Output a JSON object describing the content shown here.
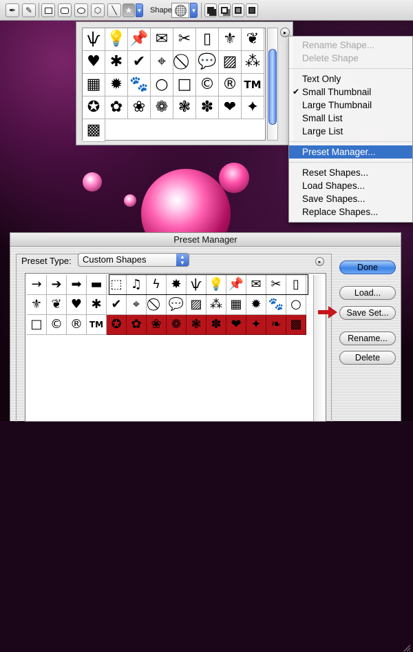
{
  "options_bar": {
    "tools": [
      {
        "name": "pen-tool",
        "glyph": "✒"
      },
      {
        "name": "freeform-pen-tool",
        "glyph": "✎"
      },
      {
        "name": "rectangle-tool",
        "glyph": ""
      },
      {
        "name": "rounded-rectangle-tool",
        "glyph": ""
      },
      {
        "name": "ellipse-tool",
        "glyph": ""
      },
      {
        "name": "polygon-tool",
        "glyph": "⬡"
      },
      {
        "name": "line-tool",
        "glyph": "╲"
      },
      {
        "name": "custom-shape-tool",
        "glyph": "★"
      }
    ],
    "shape_label": "Shape:",
    "combine_modes": [
      "add",
      "subtract",
      "intersect",
      "exclude"
    ]
  },
  "picker": {
    "shapes": [
      "ѱ",
      "💡",
      "📌",
      "✉",
      "✂",
      "▯",
      "⚜",
      "❦",
      "♥",
      "✱",
      "✔",
      "⌖",
      "⃠",
      "💬",
      "▨",
      "⁂",
      "▦",
      "✹",
      "🐾",
      "○",
      "□",
      "©",
      "®",
      "TM",
      "✪",
      "✿",
      "❀",
      "❁",
      "❃",
      "✽",
      "❤",
      "✦",
      "▩"
    ],
    "arrow_glyph": "▸"
  },
  "menu": {
    "items": [
      {
        "label": "Rename Shape...",
        "disabled": true
      },
      {
        "label": "Delete Shape",
        "disabled": true
      },
      {
        "sep": true
      },
      {
        "label": "Text Only"
      },
      {
        "label": "Small Thumbnail",
        "checked": true
      },
      {
        "label": "Large Thumbnail"
      },
      {
        "label": "Small List"
      },
      {
        "label": "Large List"
      },
      {
        "sep": true
      },
      {
        "label": "Preset Manager...",
        "highlighted": true
      },
      {
        "sep": true
      },
      {
        "label": "Reset Shapes..."
      },
      {
        "label": "Load Shapes..."
      },
      {
        "label": "Save Shapes..."
      },
      {
        "label": "Replace Shapes..."
      }
    ],
    "check_glyph": "✔"
  },
  "preset_manager": {
    "title": "Preset Manager",
    "preset_type_label": "Preset Type:",
    "preset_type_value": "Custom Shapes",
    "grid": [
      "→",
      "➔",
      "➡",
      "▬",
      "⬚",
      "♫",
      "ϟ",
      "✸",
      "ѱ",
      "💡",
      "📌",
      "✉",
      "✂",
      "▯",
      "⚜",
      "❦",
      "♥",
      "✱",
      "✔",
      "⌖",
      "⃠",
      "💬",
      "▨",
      "⁂",
      "▦",
      "✹",
      "🐾",
      "○",
      "□",
      "©",
      "®",
      "TM",
      "✪",
      "✿",
      "❀",
      "❁",
      "❃",
      "✽",
      "❤",
      "✦",
      "❧",
      "▩"
    ],
    "selected_indices": [
      32,
      33,
      34,
      35,
      36,
      37,
      38,
      39,
      40,
      41
    ],
    "buttons": {
      "done": "Done",
      "load": "Load...",
      "save_set": "Save Set...",
      "rename": "Rename...",
      "delete": "Delete"
    },
    "accent_red": "#b6141a",
    "aqua_blue": "#3e83e6"
  }
}
